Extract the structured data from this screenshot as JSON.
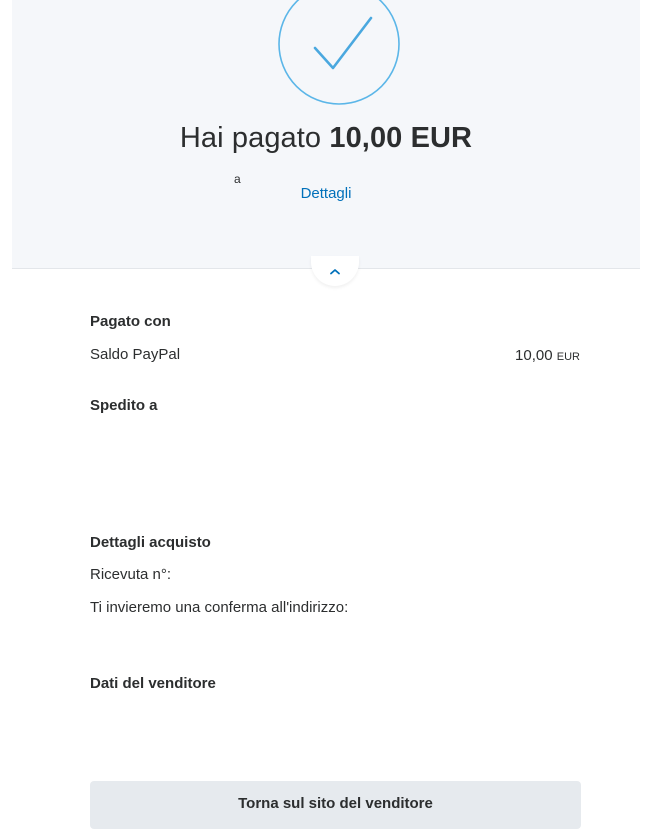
{
  "confirmation": {
    "title_prefix": "Hai pagato",
    "amount": "10,00 EUR",
    "recipient_prefix": "a",
    "details_link": "Dettagli"
  },
  "payment": {
    "section_title": "Pagato con",
    "method": "Saldo PayPal",
    "amount_value": "10,00",
    "amount_currency": "EUR"
  },
  "shipping": {
    "section_title": "Spedito a"
  },
  "purchase": {
    "section_title": "Dettagli acquisto",
    "receipt_label": "Ricevuta n°:",
    "email_notice": "Ti invieremo una conferma all'indirizzo:"
  },
  "seller": {
    "section_title": "Dati del venditore"
  },
  "return_button": "Torna sul sito del venditore",
  "colors": {
    "accent": "#0070ba",
    "check": "#5bb6e8",
    "header_bg": "#f5f7fa",
    "button_bg": "#e6eaee"
  },
  "icons": {
    "success": "checkmark-circle-icon",
    "collapse": "chevron-up-icon"
  }
}
